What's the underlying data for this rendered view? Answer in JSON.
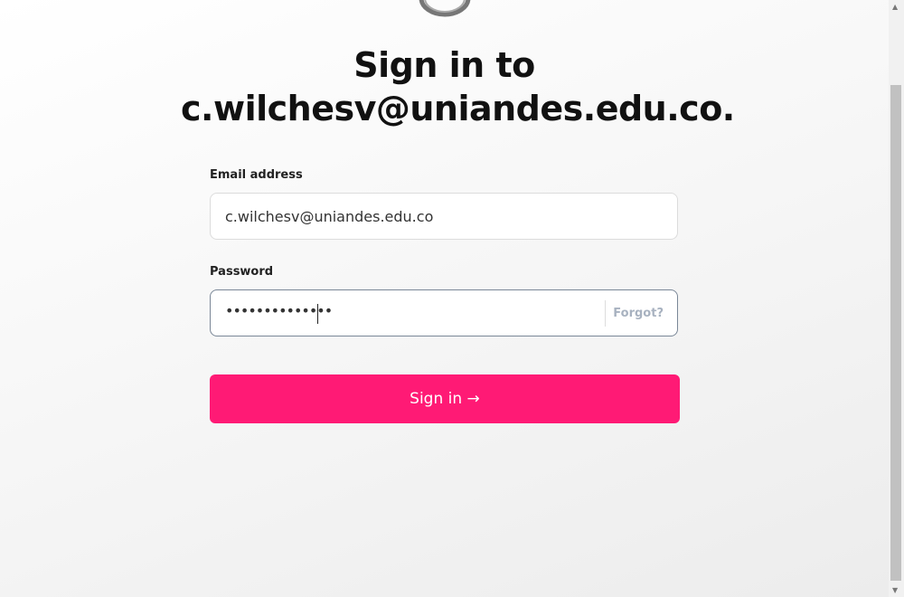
{
  "title_line1": "Sign in to",
  "title_line2": "c.wilchesv@uniandes.edu.co.",
  "email": {
    "label": "Email address",
    "value": "c.wilchesv@uniandes.edu.co"
  },
  "password": {
    "label": "Password",
    "value": "••••••••••••••",
    "forgot": "Forgot?"
  },
  "submit_label": "Sign in →",
  "colors": {
    "accent": "#ff1a75"
  }
}
